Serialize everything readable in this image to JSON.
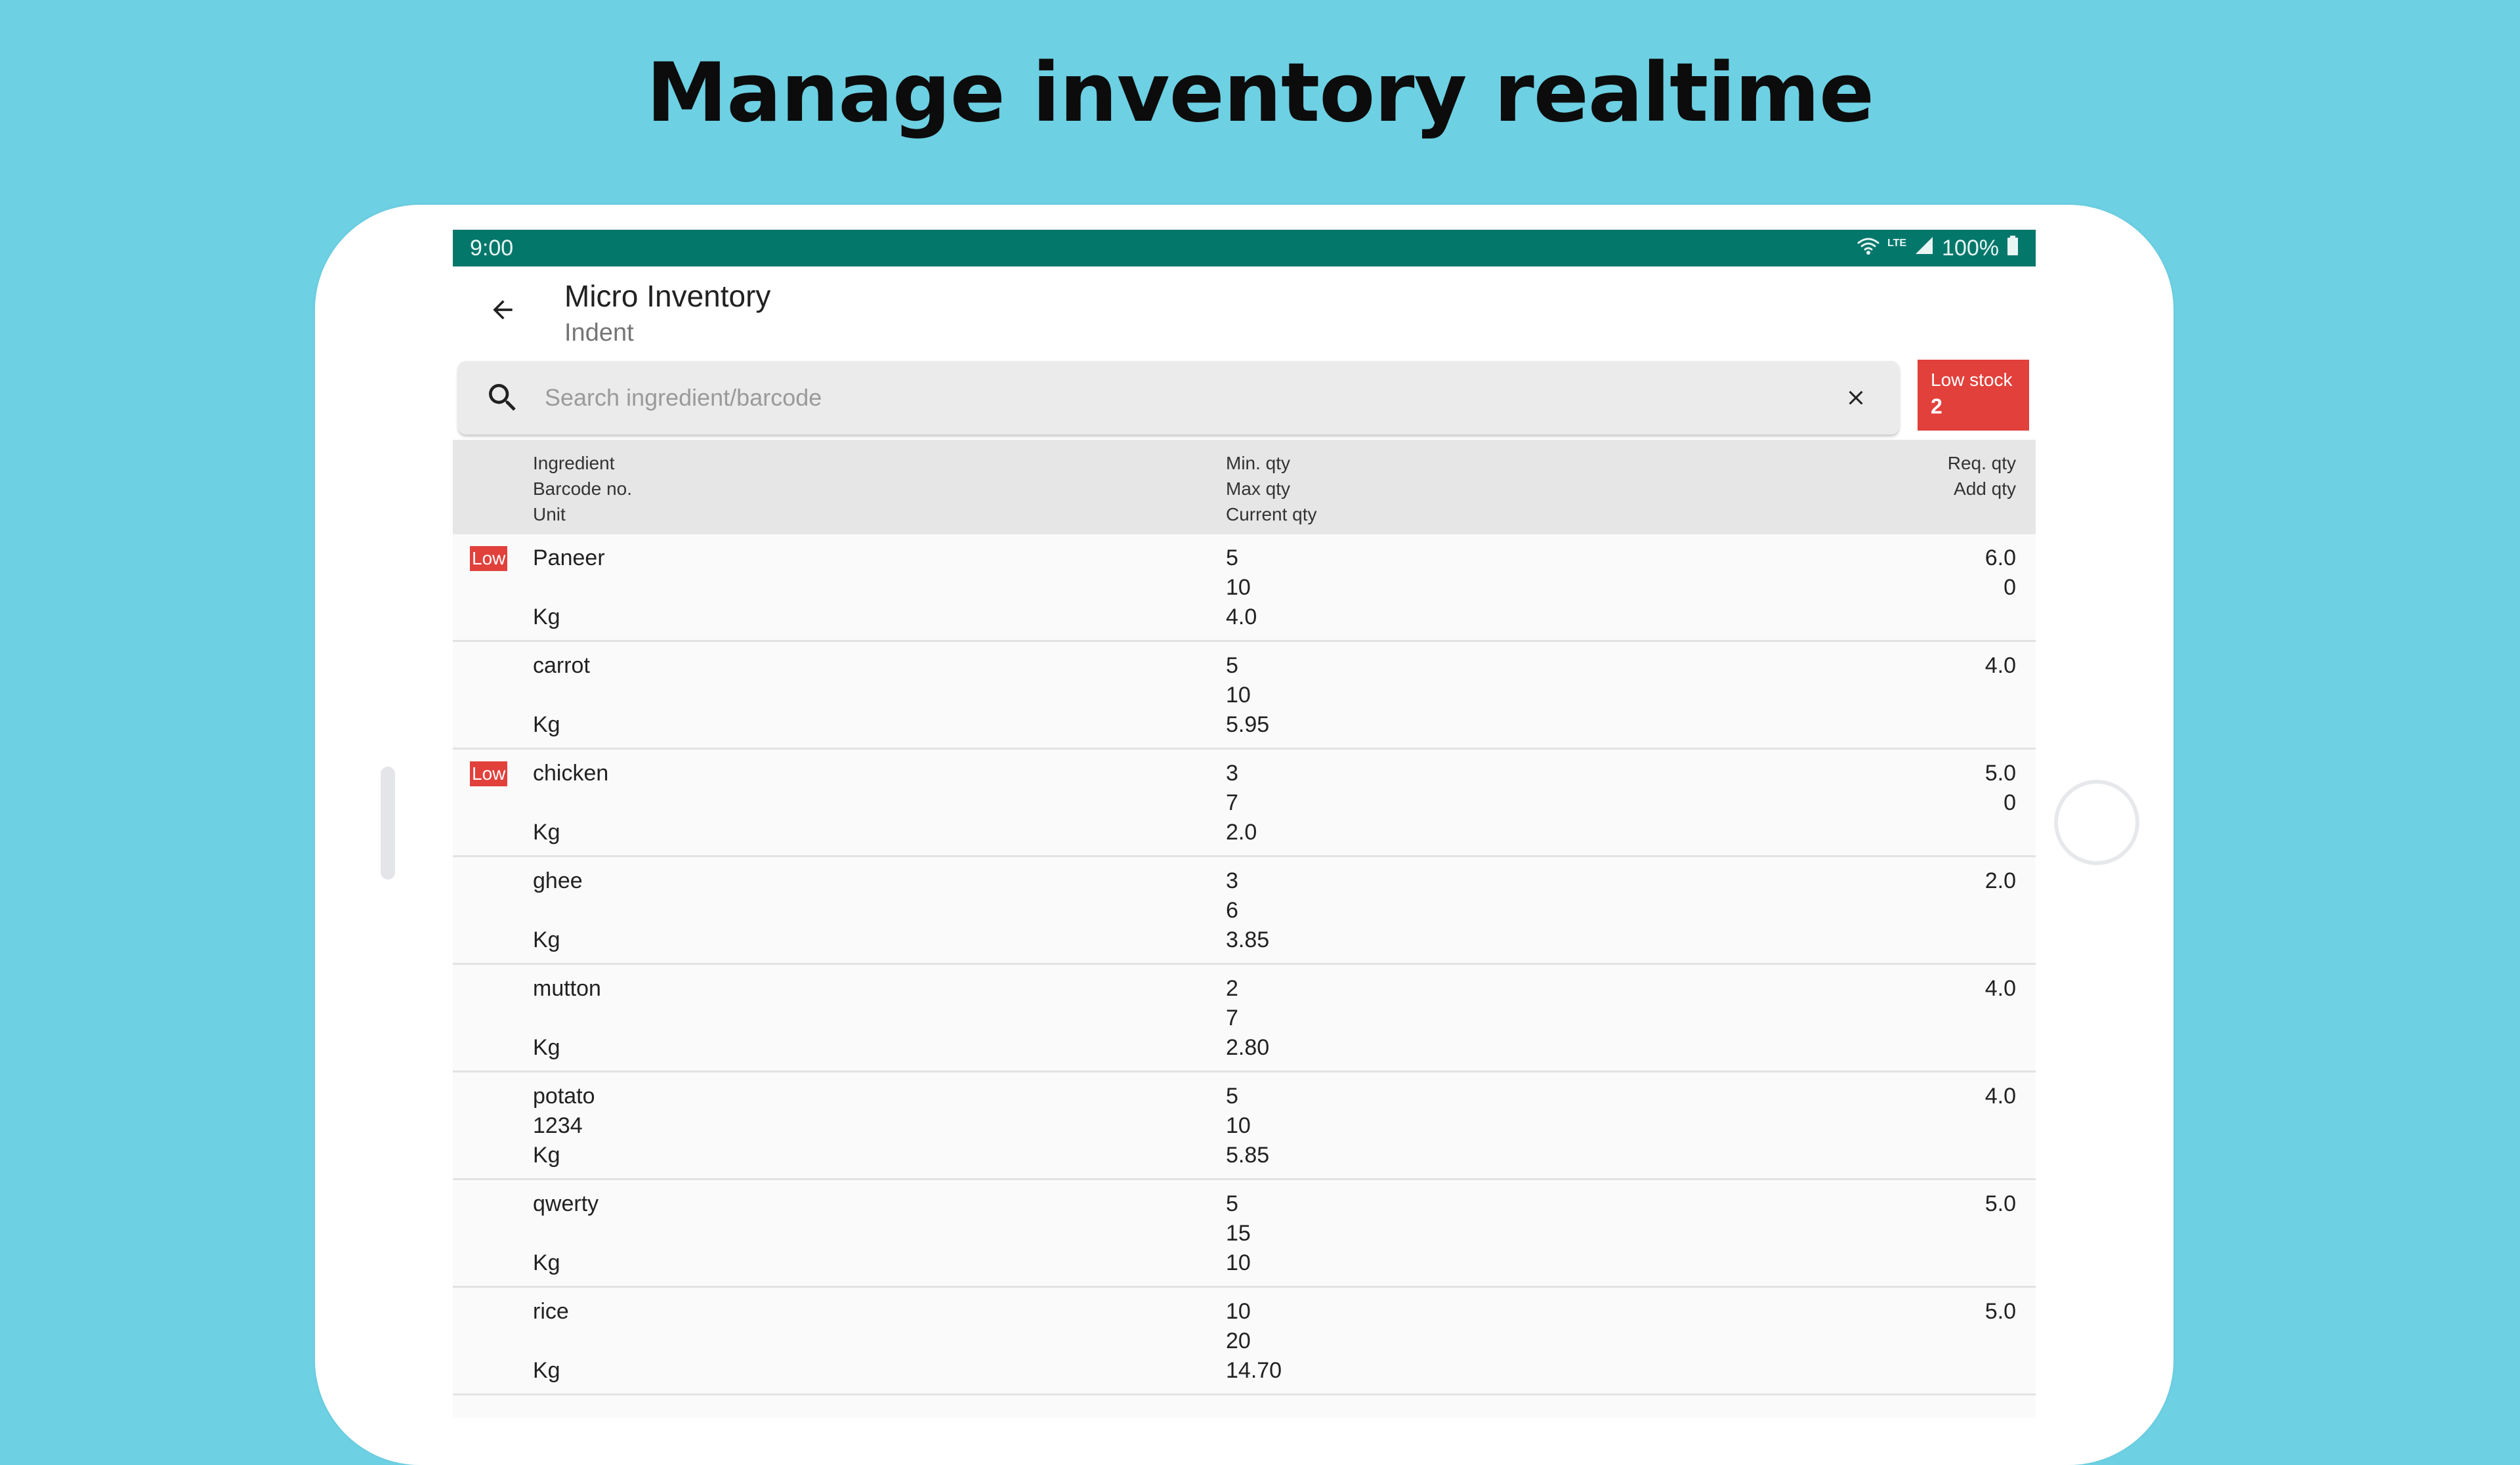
{
  "headline": "Manage inventory realtime",
  "status_bar": {
    "time": "9:00",
    "network": "LTE",
    "battery": "100%"
  },
  "app_bar": {
    "title": "Micro Inventory",
    "subtitle": "Indent"
  },
  "search": {
    "placeholder": "Search ingredient/barcode",
    "value": ""
  },
  "low_stock": {
    "label": "Low stock",
    "count": "2"
  },
  "table": {
    "headers": {
      "ingredient": "Ingredient",
      "barcode": "Barcode no.",
      "unit": "Unit",
      "min_qty": "Min. qty",
      "max_qty": "Max qty",
      "current_qty": "Current qty",
      "req_qty": "Req. qty",
      "add_qty": "Add qty"
    },
    "low_label": "Low",
    "rows": [
      {
        "low": true,
        "name": "Paneer",
        "barcode": "",
        "unit": "Kg",
        "min": "5",
        "max": "10",
        "current": "4.0",
        "req": "6.0",
        "add": "0"
      },
      {
        "low": false,
        "name": "carrot",
        "barcode": "",
        "unit": "Kg",
        "min": "5",
        "max": "10",
        "current": "5.95",
        "req": "4.0",
        "add": ""
      },
      {
        "low": true,
        "name": "chicken",
        "barcode": "",
        "unit": "Kg",
        "min": "3",
        "max": "7",
        "current": "2.0",
        "req": "5.0",
        "add": "0"
      },
      {
        "low": false,
        "name": "ghee",
        "barcode": "",
        "unit": "Kg",
        "min": "3",
        "max": "6",
        "current": "3.85",
        "req": "2.0",
        "add": ""
      },
      {
        "low": false,
        "name": "mutton",
        "barcode": "",
        "unit": "Kg",
        "min": "2",
        "max": "7",
        "current": "2.80",
        "req": "4.0",
        "add": ""
      },
      {
        "low": false,
        "name": "potato",
        "barcode": "1234",
        "unit": "Kg",
        "min": "5",
        "max": "10",
        "current": "5.85",
        "req": "4.0",
        "add": ""
      },
      {
        "low": false,
        "name": "qwerty",
        "barcode": "",
        "unit": "Kg",
        "min": "5",
        "max": "15",
        "current": "10",
        "req": "5.0",
        "add": ""
      },
      {
        "low": false,
        "name": "rice",
        "barcode": "",
        "unit": "Kg",
        "min": "10",
        "max": "20",
        "current": "14.70",
        "req": "5.0",
        "add": ""
      }
    ]
  },
  "colors": {
    "background": "#6dd0e3",
    "status_bar": "#04776b",
    "low_stock_red": "#e2403b",
    "header_gray": "#e6e6e6"
  },
  "icons": {
    "back": "arrow-back-icon",
    "search": "search-icon",
    "clear": "close-icon",
    "wifi": "wifi-icon",
    "signal": "signal-icon",
    "battery": "battery-icon"
  }
}
